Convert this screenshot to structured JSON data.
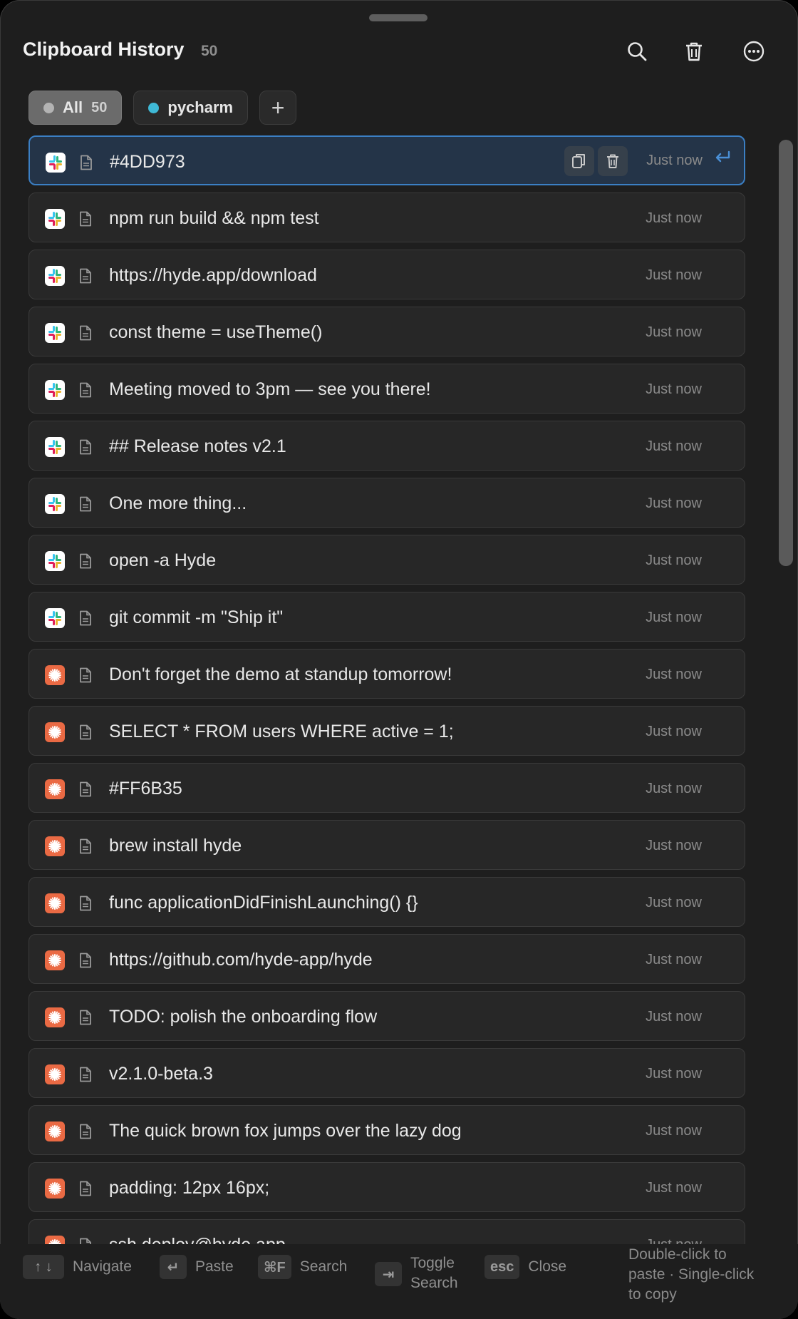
{
  "header": {
    "title": "Clipboard History",
    "count": "50",
    "buttons": [
      "search-icon",
      "trash-icon",
      "more-icon"
    ]
  },
  "tabs": [
    {
      "label": "All",
      "count": "50",
      "dot_color": "#b3b3b3",
      "active": true
    },
    {
      "label": "pycharm",
      "dot_color": "#3fb9d6",
      "active": false
    }
  ],
  "add_tab_label": "+",
  "items": [
    {
      "text": "#4DD973",
      "time": "Just now",
      "app": "slack"
    },
    {
      "text": "npm run build && npm test",
      "time": "Just now",
      "app": "slack"
    },
    {
      "text": "https://hyde.app/download",
      "time": "Just now",
      "app": "slack"
    },
    {
      "text": "const theme = useTheme()",
      "time": "Just now",
      "app": "slack"
    },
    {
      "text": "Meeting moved to 3pm — see you there!",
      "time": "Just now",
      "app": "slack"
    },
    {
      "text": "## Release notes v2.1",
      "time": "Just now",
      "app": "slack"
    },
    {
      "text": "One more thing...",
      "time": "Just now",
      "app": "slack"
    },
    {
      "text": "open -a Hyde",
      "time": "Just now",
      "app": "slack"
    },
    {
      "text": "git commit -m \"Ship it\"",
      "time": "Just now",
      "app": "slack"
    },
    {
      "text": "Don't forget the demo at standup tomorrow!",
      "time": "Just now",
      "app": "claude"
    },
    {
      "text": "SELECT * FROM users WHERE active = 1;",
      "time": "Just now",
      "app": "claude"
    },
    {
      "text": "#FF6B35",
      "time": "Just now",
      "app": "claude"
    },
    {
      "text": "brew install hyde",
      "time": "Just now",
      "app": "claude"
    },
    {
      "text": "func applicationDidFinishLaunching() {}",
      "time": "Just now",
      "app": "claude"
    },
    {
      "text": "https://github.com/hyde-app/hyde",
      "time": "Just now",
      "app": "claude"
    },
    {
      "text": "TODO: polish the onboarding flow",
      "time": "Just now",
      "app": "claude"
    },
    {
      "text": "v2.1.0-beta.3",
      "time": "Just now",
      "app": "claude"
    },
    {
      "text": "The quick brown fox jumps over the lazy dog",
      "time": "Just now",
      "app": "claude"
    },
    {
      "text": "padding: 12px 16px;",
      "time": "Just now",
      "app": "claude"
    },
    {
      "text": "ssh deploy@hyde.app",
      "time": "Just now",
      "app": "claude"
    }
  ],
  "footer": {
    "navigate_keys": "↑ ↓",
    "navigate_label": "Navigate",
    "paste_key": "↵",
    "paste_label": "Paste",
    "search_key": "⌘F",
    "search_label": "Search",
    "toggle_key": "⇥",
    "toggle_label_1": "Toggle",
    "toggle_label_2": "Search",
    "close_key": "esc",
    "close_label": "Close",
    "help_line_1": "Double-click to",
    "help_line_2": "paste · Single-click",
    "help_line_3": "to copy"
  },
  "colors": {
    "accent": "#3b7fc4",
    "slack_app": "#ffffff",
    "claude_app": "#ea6a44"
  }
}
